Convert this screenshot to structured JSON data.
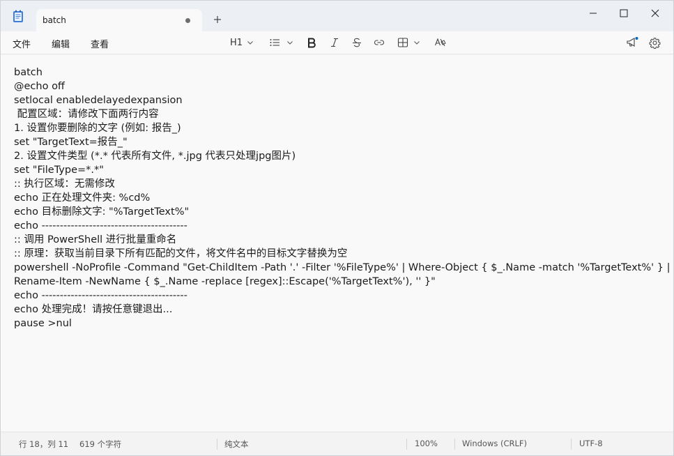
{
  "tab": {
    "title": "batch",
    "unsaved": true
  },
  "menu": [
    "文件",
    "编辑",
    "查看"
  ],
  "toolbar": {
    "heading": "H1",
    "tools": [
      "list-icon",
      "bold-icon",
      "italic-icon",
      "strikethrough-icon",
      "link-icon",
      "table-icon",
      "clear-format-icon"
    ]
  },
  "editor": {
    "lines": [
      "batch",
      "@echo off",
      "setlocal enabledelayedexpansion",
      " 配置区域：请修改下面两行内容",
      "1. 设置你要删除的文字 (例如: 报告_)",
      "set \"TargetText=报告_\"",
      "2. 设置文件类型 (*.* 代表所有文件, *.jpg 代表只处理jpg图片)",
      "set \"FileType=*.*\"",
      ":: 执行区域：无需修改",
      "echo 正在处理文件夹: %cd%",
      "echo 目标删除文字: \"%TargetText%\"",
      "echo ----------------------------------------",
      ":: 调用 PowerShell 进行批量重命名",
      ":: 原理：获取当前目录下所有匹配的文件，将文件名中的目标文字替换为空",
      "powershell -NoProfile -Command \"Get-ChildItem -Path '.' -Filter '%FileType%' | Where-Object { $_.Name -match '%TargetText%' } |",
      "Rename-Item -NewName { $_.Name -replace [regex]::Escape('%TargetText%'), '' }\"",
      "echo ----------------------------------------",
      "echo 处理完成！请按任意键退出...",
      "pause >nul"
    ]
  },
  "status": {
    "position": "行 18，列 11",
    "chars": "619 个字符",
    "format": "纯文本",
    "zoom": "100%",
    "line_ending": "Windows (CRLF)",
    "encoding": "UTF-8"
  },
  "colors": {
    "accent": "#0067c0",
    "icon_blue": "#3f7fd8"
  }
}
